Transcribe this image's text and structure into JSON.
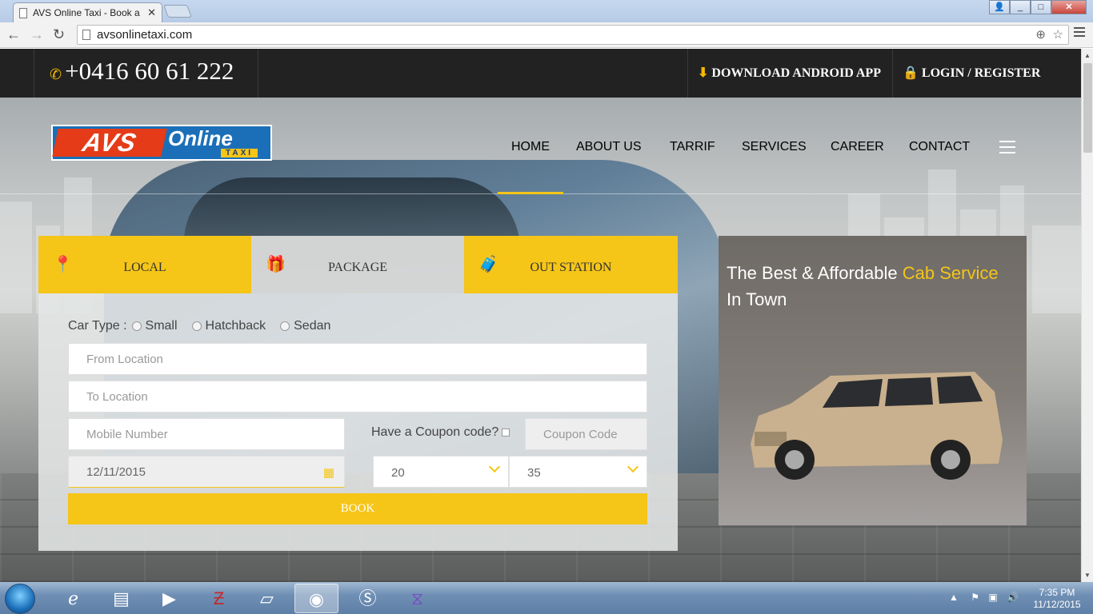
{
  "browser": {
    "tab_title": "AVS Online Taxi - Book a",
    "url": "avsonlinetaxi.com",
    "window_buttons": [
      "_",
      "□",
      "✕"
    ]
  },
  "topbar": {
    "phone": "+0416 60 61 222",
    "download_app": "DOWNLOAD ANDROID APP",
    "login": "LOGIN / REGISTER"
  },
  "logo": {
    "avs": "AVS",
    "online": "Online",
    "taxi": "TAXI"
  },
  "nav": {
    "items": [
      "HOME",
      "ABOUT US",
      "TARRIF",
      "SERVICES",
      "CAREER",
      "CONTACT"
    ],
    "active": "HOME"
  },
  "booking": {
    "tabs": [
      "LOCAL",
      "PACKAGE",
      "OUT STATION"
    ],
    "active_tab": "LOCAL",
    "car_type_label": "Car Type :",
    "car_types": [
      "Small",
      "Hatchback",
      "Sedan"
    ],
    "from_placeholder": "From Location",
    "to_placeholder": "To Location",
    "mobile_placeholder": "Mobile Number",
    "coupon_question": "Have a Coupon code?",
    "coupon_placeholder": "Coupon Code",
    "date_value": "12/11/2015",
    "hour_value": "20",
    "minute_value": "35",
    "book_label": "BOOK"
  },
  "promo": {
    "text_before": "The Best & Affordable ",
    "highlight": "Cab Service",
    "text_after": "In Town"
  },
  "taskbar": {
    "apps": [
      "ie-icon",
      "explorer-icon",
      "media-player-icon",
      "filezilla-icon",
      "notepad-icon",
      "chrome-icon",
      "skype-icon",
      "visual-studio-icon"
    ],
    "active_app": "chrome-icon",
    "time": "7:35 PM",
    "date": "11/12/2015"
  },
  "colors": {
    "accent": "#f5c518",
    "topbar": "#222222",
    "logo_blue": "#1b6fb8",
    "logo_red": "#e53b18"
  }
}
